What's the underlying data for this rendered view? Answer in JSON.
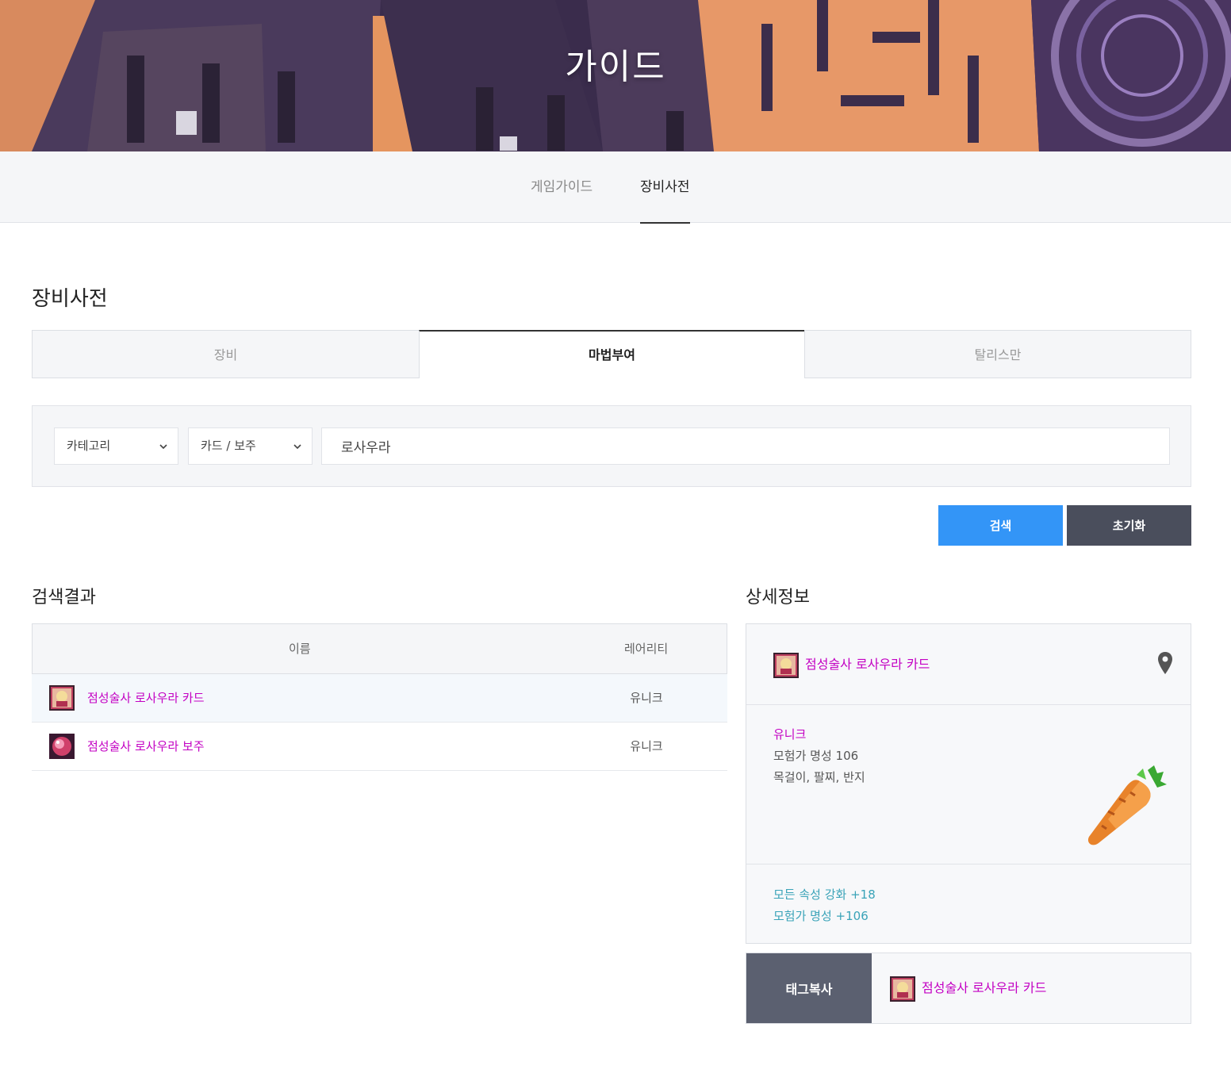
{
  "hero": {
    "title": "가이드"
  },
  "subnav": {
    "tabs": [
      {
        "label": "게임가이드"
      },
      {
        "label": "장비사전"
      }
    ]
  },
  "page": {
    "title": "장비사전"
  },
  "tabs": [
    {
      "label": "장비"
    },
    {
      "label": "마법부여"
    },
    {
      "label": "탈리스만"
    }
  ],
  "search": {
    "category": "카테고리",
    "subcategory": "카드 / 보주",
    "query": "로사우라",
    "search_label": "검색",
    "reset_label": "초기화"
  },
  "results": {
    "title": "검색결과",
    "columns": {
      "name": "이름",
      "rarity": "레어리티"
    },
    "rows": [
      {
        "name": "점성술사 로사우라 카드",
        "rarity": "유니크"
      },
      {
        "name": "점성술사 로사우라 보주",
        "rarity": "유니크"
      }
    ]
  },
  "detail": {
    "title": "상세정보",
    "name": "점성술사 로사우라 카드",
    "rarity": "유니크",
    "fame": "모험가 명성 106",
    "slots": "목걸이,  팔찌,  반지",
    "options": [
      "모든 속성 강화 +18",
      "모험가 명성 +106"
    ],
    "tag_copy_label": "태그복사",
    "tag_name": "점성술사 로사우라 카드"
  },
  "colors": {
    "unique": "#c300c3",
    "option": "#3aa3b8",
    "search_btn": "#3395f7",
    "reset_btn": "#4a4e5c",
    "tag_btn": "#5b6070"
  },
  "icons": [
    "chevron-down-icon",
    "map-pin-icon",
    "card-icon",
    "orb-icon",
    "carrot-icon"
  ]
}
